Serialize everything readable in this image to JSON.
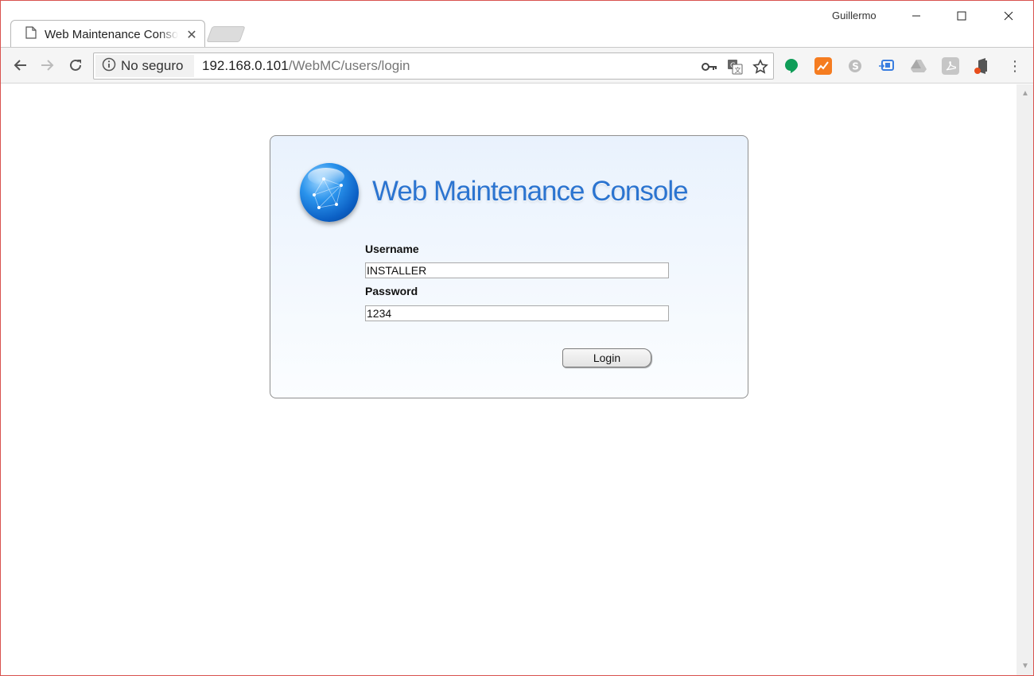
{
  "browser": {
    "tab_title": "Web Maintenance Console",
    "profile_name": "Guillermo",
    "security_label": "No seguro",
    "url_host": "192.168.0.101",
    "url_path": "/WebMC/users/login"
  },
  "login": {
    "title": "Web Maintenance Console",
    "username_label": "Username",
    "username_value": "INSTALLER",
    "password_label": "Password",
    "password_value": "1234",
    "login_label": "Login"
  },
  "colors": {
    "accent": "#2b74d0",
    "window_border": "#d9534f"
  }
}
